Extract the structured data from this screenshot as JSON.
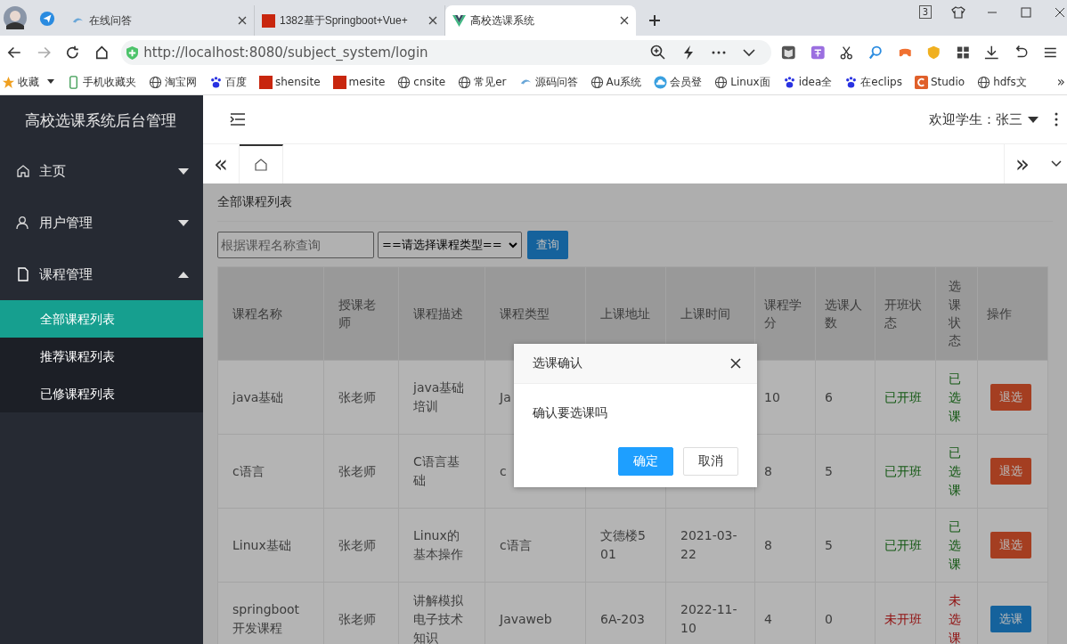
{
  "browser": {
    "tabs": [
      {
        "title": "在线问答",
        "selected": false
      },
      {
        "title": "1382基于Springboot+Vue+",
        "selected": false
      },
      {
        "title": "高校选课系统",
        "selected": true
      }
    ],
    "window_badge": "3",
    "address": "http://localhost:8080/subject_system/login",
    "bookmarks": [
      {
        "label": "收藏",
        "kind": "star"
      },
      {
        "label": "手机收藏夹",
        "kind": "phone"
      },
      {
        "label": "淘宝网",
        "kind": "globe"
      },
      {
        "label": "百度",
        "kind": "paw"
      },
      {
        "label": "shensite",
        "kind": "tile"
      },
      {
        "label": "mesite",
        "kind": "tile"
      },
      {
        "label": "cnsite",
        "kind": "globe"
      },
      {
        "label": "常见er",
        "kind": "globe"
      },
      {
        "label": "源码问答",
        "kind": "swirl"
      },
      {
        "label": "Au系统",
        "kind": "globe"
      },
      {
        "label": "会员登",
        "kind": "cloud"
      },
      {
        "label": "Linux面",
        "kind": "globe"
      },
      {
        "label": "idea全",
        "kind": "paw"
      },
      {
        "label": "在eclips",
        "kind": "paw"
      },
      {
        "label": "Studio",
        "kind": "studio"
      },
      {
        "label": "hdfs文",
        "kind": "globe"
      }
    ],
    "more": "»"
  },
  "sidebar": {
    "title": "高校选课系统后台管理",
    "items": [
      {
        "label": "主页",
        "kind": "home",
        "expanded": false
      },
      {
        "label": "用户管理",
        "kind": "user",
        "expanded": false
      },
      {
        "label": "课程管理",
        "kind": "doc",
        "expanded": true,
        "children": [
          {
            "label": "全部课程列表",
            "selected": true
          },
          {
            "label": "推荐课程列表",
            "selected": false
          },
          {
            "label": "已修课程列表",
            "selected": false
          }
        ]
      }
    ]
  },
  "header": {
    "welcome": "欢迎学生：张三"
  },
  "nav": {
    "prev": "«",
    "next": "»"
  },
  "content": {
    "breadcrumb": "全部课程列表",
    "search": {
      "placeholder": "根据课程名称查询"
    },
    "type_select": "==请选择课程类型==",
    "query_button": "查询",
    "columns": [
      "课程名称",
      "授课老师",
      "课程描述",
      "课程类型",
      "上课地址",
      "上课时间",
      "课程学分",
      "选课人数",
      "开班状态",
      "选课状态",
      "操作"
    ],
    "rows": [
      {
        "name": "java基础",
        "teacher": "张老师",
        "desc": "java基础培训",
        "type": "Ja",
        "credit": "10",
        "count": "6",
        "open_status": {
          "label": "已开班",
          "open": true
        },
        "choose_status": {
          "label": "已选课",
          "chosen": true
        },
        "action": {
          "label": "退选",
          "kind": "drop"
        }
      },
      {
        "name": "c语言",
        "teacher": "张老师",
        "desc": "C语言基础",
        "type": "c",
        "credit": "8",
        "count": "5",
        "open_status": {
          "label": "已开班",
          "open": true
        },
        "choose_status": {
          "label": "已选课",
          "chosen": true
        },
        "action": {
          "label": "退选",
          "kind": "drop"
        }
      },
      {
        "name": "Linux基础",
        "teacher": "张老师",
        "desc": "Linux的基本操作",
        "type": "c语言",
        "address": "文德楼501",
        "time": "2021-03-22",
        "credit": "8",
        "count": "5",
        "open_status": {
          "label": "已开班",
          "open": true
        },
        "choose_status": {
          "label": "已选课",
          "chosen": true
        },
        "action": {
          "label": "退选",
          "kind": "drop"
        }
      },
      {
        "name": "springboot开发课程",
        "teacher": "张老师",
        "desc": "讲解模拟电子技术知识",
        "type": "Javaweb",
        "address": "6A-203",
        "time": "2022-11-10",
        "credit": "4",
        "count": "0",
        "open_status": {
          "label": "未开班",
          "open": false
        },
        "choose_status": {
          "label": "未选课",
          "chosen": false
        },
        "action": {
          "label": "选课",
          "kind": "choose"
        }
      }
    ]
  },
  "dialog": {
    "title": "选课确认",
    "message": "确认要选课吗",
    "buttons": [
      {
        "label": "确定",
        "kind": "primary"
      },
      {
        "label": "取消",
        "kind": "default"
      }
    ]
  }
}
